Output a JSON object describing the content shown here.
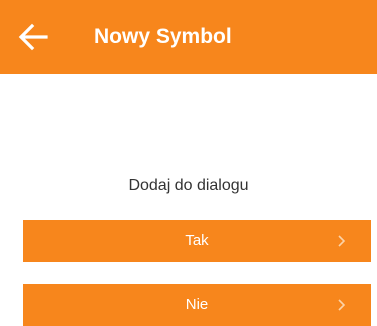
{
  "app_bar": {
    "title": "Nowy Symbol",
    "back_icon": "arrow-left-icon",
    "color": "#f7861c"
  },
  "dialog": {
    "prompt": "Dodaj do dialogu",
    "options": [
      {
        "label": "Tak",
        "icon": "chevron-right-icon"
      },
      {
        "label": "Nie",
        "icon": "chevron-right-icon"
      }
    ]
  }
}
